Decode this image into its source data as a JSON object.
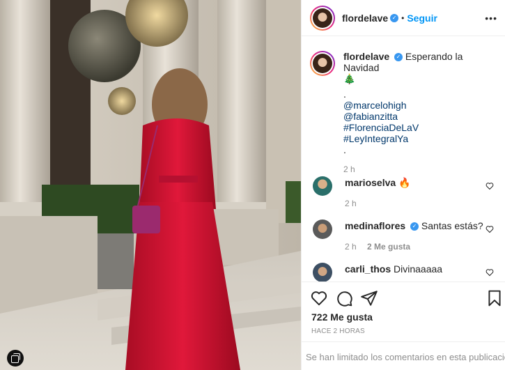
{
  "post": {
    "author": "flordelave",
    "follow_label": "Seguir",
    "more_label": "•••",
    "separator": "•",
    "verified_mark": "✓"
  },
  "caption": {
    "username": "flordelave",
    "text": "Esperando la Navidad",
    "emoji": "🎄",
    "dot1": ".",
    "mentions": [
      "@marcelohigh",
      "@fabianzitta"
    ],
    "hashtags": [
      "#FlorenciaDeLaV",
      "#LeyIntegralYa"
    ],
    "dot2": ".",
    "time": "2 h"
  },
  "comments": [
    {
      "username": "marioselva",
      "text": "",
      "emoji": "🔥",
      "time": "2 h",
      "likes": ""
    },
    {
      "username": "medinaflores",
      "verified": true,
      "text": "Santas estás?",
      "time": "2 h",
      "likes": "2 Me gusta"
    },
    {
      "username": "carli_thos",
      "text": "Divinaaaaa",
      "time": "",
      "likes": ""
    }
  ],
  "actions": {
    "like_icon": "heart-icon",
    "comment_icon": "comment-icon",
    "share_icon": "share-icon",
    "save_icon": "bookmark-icon"
  },
  "likes_count": "722 Me gusta",
  "time_ago": "HACE 2 HORAS",
  "comments_limited": "Se han limitado los comentarios en esta publicación",
  "colors": {
    "accent": "#0095f6",
    "verified": "#3897f0",
    "link": "#00376b",
    "muted": "#8e8e8e",
    "dress": "#c8102e"
  }
}
